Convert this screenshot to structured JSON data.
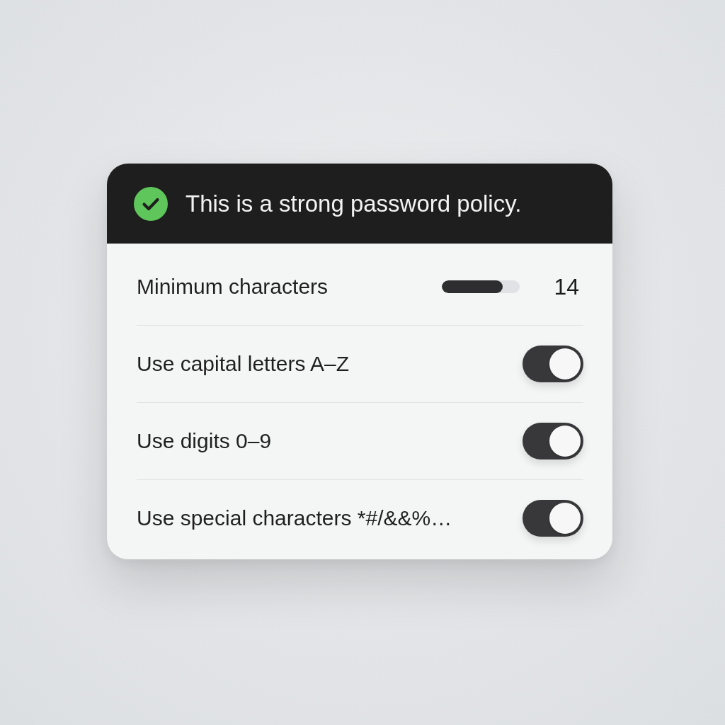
{
  "banner": {
    "text": "This is a strong password policy."
  },
  "settings": [
    {
      "kind": "slider",
      "label": "Minimum characters",
      "level": 0.78,
      "value": "14"
    },
    {
      "kind": "toggle",
      "label": "Use capital letters A–Z",
      "on": true
    },
    {
      "kind": "toggle",
      "label": "Use digits 0–9",
      "on": true
    },
    {
      "kind": "toggle",
      "label": "Use special characters *#/&&%…",
      "on": true
    }
  ]
}
